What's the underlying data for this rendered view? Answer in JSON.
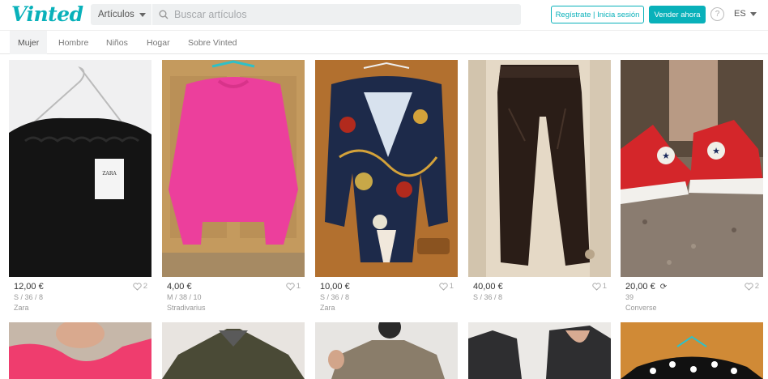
{
  "header": {
    "logo": "Vinted",
    "category_select": "Artículos",
    "search_placeholder": "Buscar artículos",
    "register_label": "Regístrate | Inicia sesión",
    "sell_label": "Vender ahora",
    "help_label": "?",
    "language": "ES"
  },
  "nav": {
    "items": [
      "Mujer",
      "Hombre",
      "Niños",
      "Hogar",
      "Sobre Vinted"
    ]
  },
  "items": [
    {
      "price": "12,00 €",
      "size": "S / 36 / 8",
      "brand": "Zara",
      "favorites": "2",
      "swap": false
    },
    {
      "price": "4,00 €",
      "size": "M / 38 / 10",
      "brand": "Stradivarius",
      "favorites": "1",
      "swap": false
    },
    {
      "price": "10,00 €",
      "size": "S / 36 / 8",
      "brand": "Zara",
      "favorites": "1",
      "swap": false
    },
    {
      "price": "40,00 €",
      "size": "S / 36 / 8",
      "brand": "",
      "favorites": "1",
      "swap": false
    },
    {
      "price": "20,00 €",
      "size": "39",
      "brand": "Converse",
      "favorites": "2",
      "swap": true
    }
  ],
  "tag_text": "ZARA",
  "colors": {
    "brand": "#09b1ba",
    "text_muted": "#999999"
  }
}
